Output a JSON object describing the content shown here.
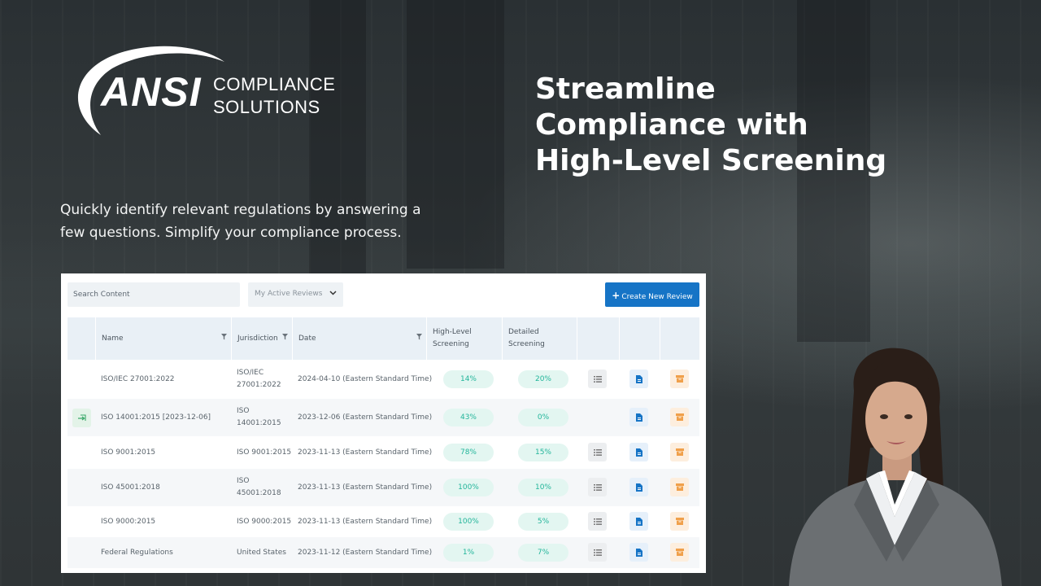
{
  "brand": {
    "logo_main": "ANSI",
    "logo_line1": "COMPLIANCE",
    "logo_line2": "SOLUTIONS"
  },
  "headline": {
    "line1": "Streamline",
    "line2": "Compliance with",
    "line3": "High-Level Screening"
  },
  "subtitle": "Quickly identify relevant regulations by answering a few questions. Simplify your compliance process.",
  "toolbar": {
    "search_placeholder": "Search Content",
    "filter_value": "My Active Reviews",
    "create_label": "Create New Review"
  },
  "table": {
    "columns": {
      "name": "Name",
      "jurisdiction": "Jurisdiction",
      "date": "Date",
      "high_level_1": "High-Level",
      "high_level_2": "Screening",
      "detailed_1": "Detailed",
      "detailed_2": "Screening"
    },
    "rows": [
      {
        "name": "ISO/IEC 27001:2022",
        "jur1": "ISO/IEC",
        "jur2": "27001:2022",
        "date": "2024-04-10 (Eastern Standard Time)",
        "high": "14%",
        "detailed": "20%"
      },
      {
        "name": "ISO 14001:2015 [2023-12-06]",
        "jur1": "ISO",
        "jur2": "14001:2015",
        "date": "2023-12-06 (Eastern Standard Time)",
        "high": "43%",
        "detailed": "0%"
      },
      {
        "name": "ISO 9001:2015",
        "jur1": "ISO 9001:2015",
        "jur2": "",
        "date": "2023-11-13 (Eastern Standard Time)",
        "high": "78%",
        "detailed": "15%"
      },
      {
        "name": "ISO 45001:2018",
        "jur1": "ISO",
        "jur2": "45001:2018",
        "date": "2023-11-13 (Eastern Standard Time)",
        "high": "100%",
        "detailed": "10%"
      },
      {
        "name": "ISO 9000:2015",
        "jur1": "ISO 9000:2015",
        "jur2": "",
        "date": "2023-11-13 (Eastern Standard Time)",
        "high": "100%",
        "detailed": "5%"
      },
      {
        "name": "Federal Regulations",
        "jur1": "United States",
        "jur2": "",
        "date": "2023-11-12 (Eastern Standard Time)",
        "high": "1%",
        "detailed": "7%"
      }
    ]
  },
  "colors": {
    "accent": "#1674c6",
    "pill_text": "#22b59a",
    "pill_bg": "#e3f6f1"
  },
  "icons": [
    "filter-icon",
    "chevron-down-icon",
    "plus-icon",
    "list-icon",
    "document-icon",
    "archive-icon",
    "move-icon"
  ]
}
